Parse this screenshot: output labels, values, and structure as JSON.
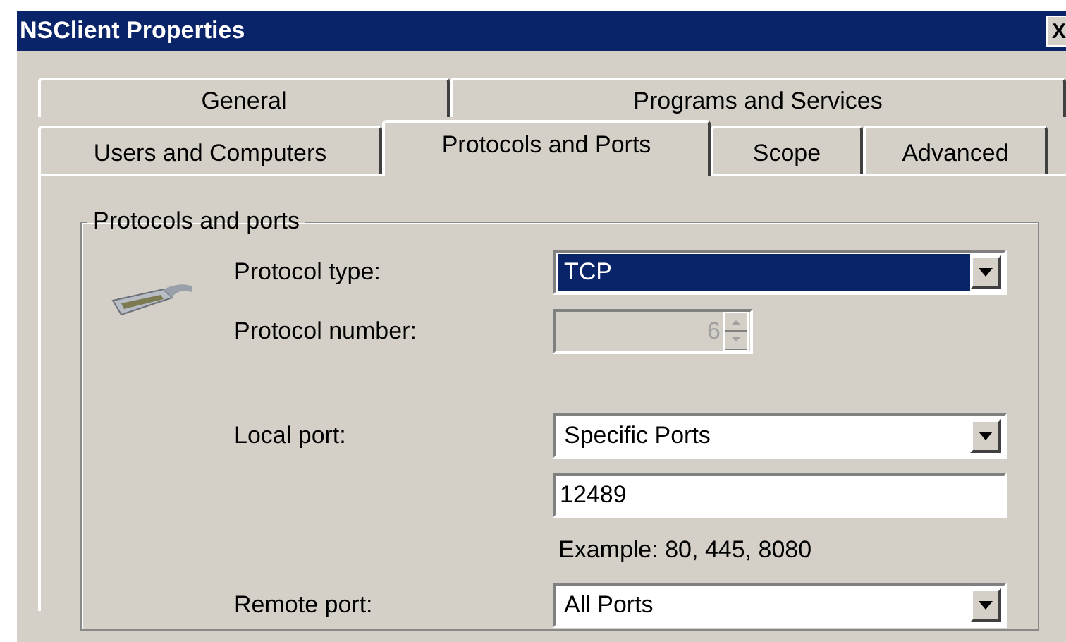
{
  "window": {
    "title": "NSClient Properties",
    "close": "X"
  },
  "tab_rows": [
    {
      "tabs": [
        {
          "label": "General",
          "selected": false
        },
        {
          "label": "Programs and Services",
          "selected": false
        }
      ]
    },
    {
      "tabs": [
        {
          "label": "Users and Computers",
          "selected": false
        },
        {
          "label": "Protocols and Ports",
          "selected": true
        },
        {
          "label": "Scope",
          "selected": false
        },
        {
          "label": "Advanced",
          "selected": false
        }
      ]
    }
  ],
  "group": {
    "label": "Protocols and ports",
    "rows": [
      {
        "kind": "combo",
        "label": "Protocol type:",
        "value": "TCP",
        "highlighted": true,
        "disabled": false
      },
      {
        "kind": "spinner",
        "label": "Protocol number:",
        "value": "6",
        "disabled": true
      },
      {
        "kind": "combo",
        "label": "Local port:",
        "value": "Specific Ports",
        "highlighted": false,
        "disabled": false
      },
      {
        "kind": "input",
        "value": "12489",
        "disabled": false
      },
      {
        "kind": "hint",
        "text": "Example: 80, 445, 8080"
      },
      {
        "kind": "combo",
        "label": "Remote port:",
        "value": "All Ports",
        "highlighted": false,
        "disabled": false
      }
    ]
  }
}
